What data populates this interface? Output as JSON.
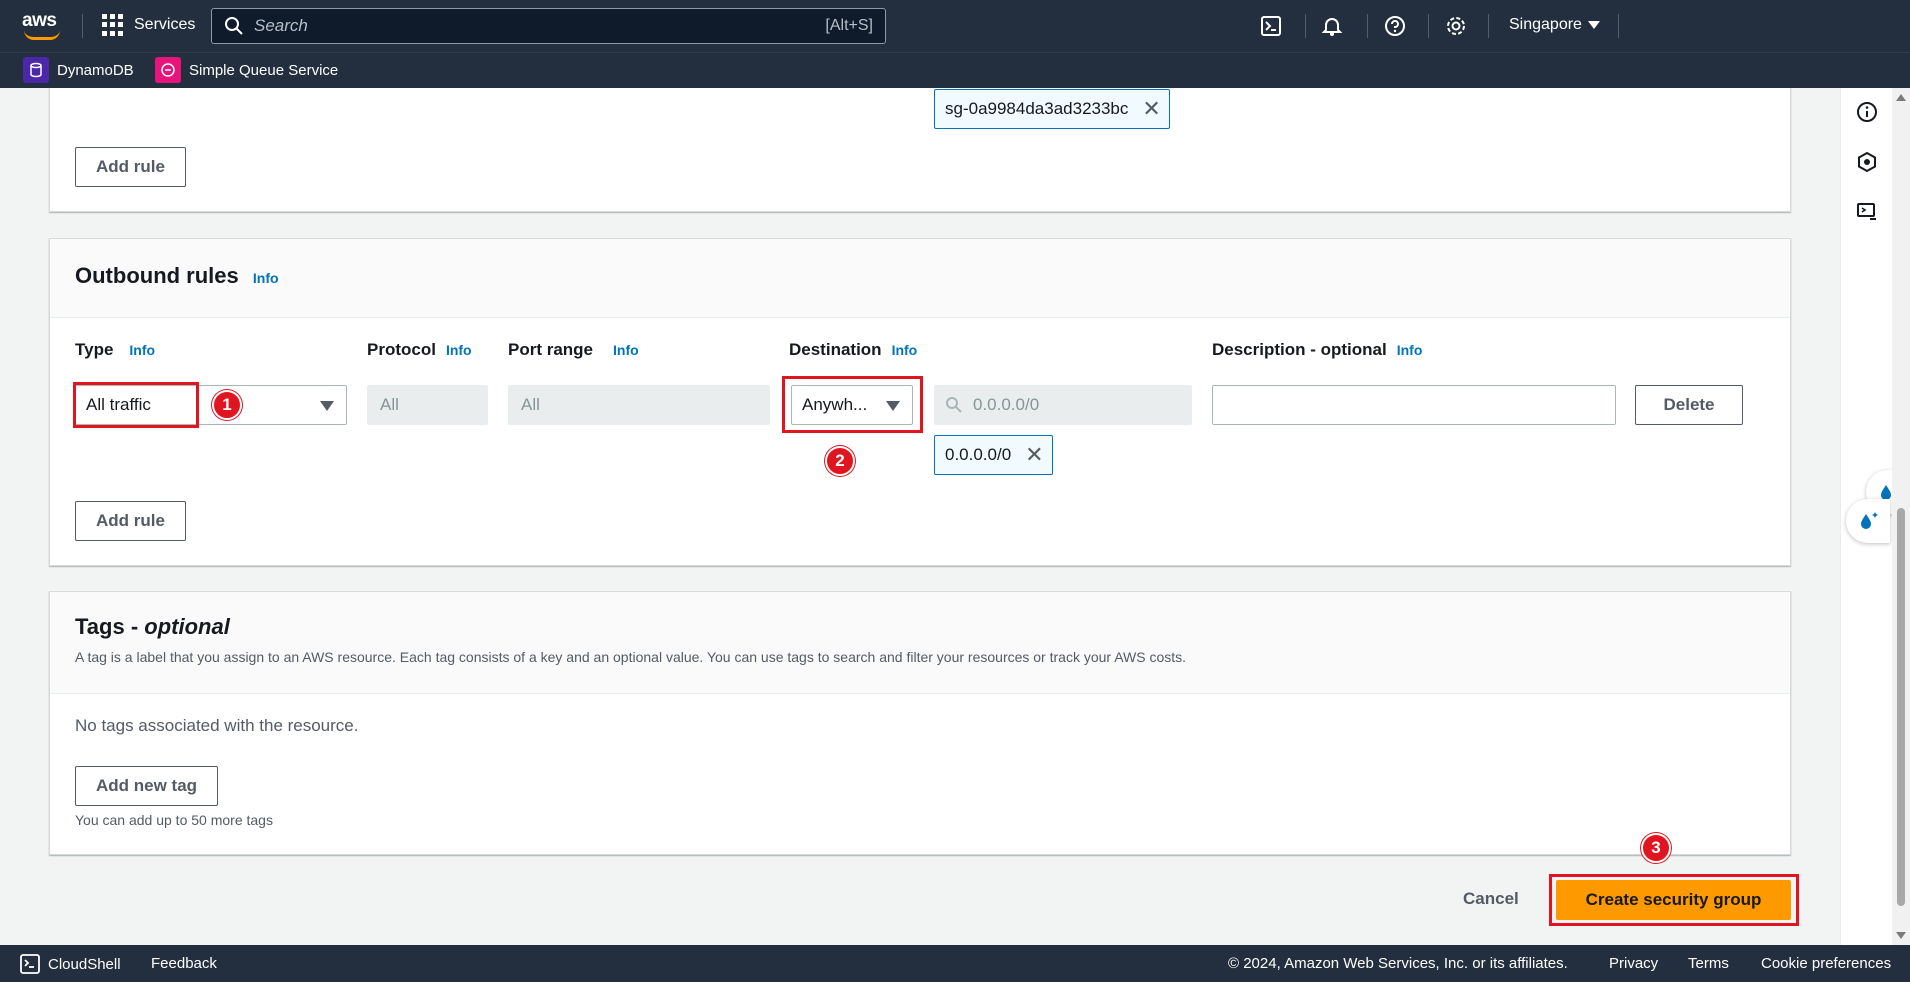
{
  "topnav": {
    "logo_text": "aws",
    "services_label": "Services",
    "search_placeholder": "Search",
    "search_shortcut": "[Alt+S]",
    "region": "Singapore"
  },
  "favorites": [
    {
      "label": "DynamoDB",
      "color": "#4d27aa"
    },
    {
      "label": "Simple Queue Service",
      "color": "#e7157b"
    }
  ],
  "inbound_partial": {
    "source_token": "sg-0a9984da3ad3233bc",
    "add_rule_label": "Add rule"
  },
  "outbound": {
    "title": "Outbound rules",
    "info": "Info",
    "columns": {
      "type": "Type",
      "protocol": "Protocol",
      "port_range": "Port range",
      "destination": "Destination",
      "description": "Description - optional"
    },
    "row": {
      "type_value": "All traffic",
      "protocol_value": "All",
      "port_value": "All",
      "destination_value": "Anywh...",
      "cidr_placeholder": "0.0.0.0/0",
      "cidr_token": "0.0.0.0/0",
      "description_value": "",
      "delete_label": "Delete"
    },
    "add_rule_label": "Add rule"
  },
  "tags": {
    "title_main": "Tags - ",
    "title_optional": "optional",
    "description": "A tag is a label that you assign to an AWS resource. Each tag consists of a key and an optional value. You can use tags to search and filter your resources or track your AWS costs.",
    "empty_text": "No tags associated with the resource.",
    "add_tag_label": "Add new tag",
    "hint": "You can add up to 50 more tags"
  },
  "actions": {
    "cancel_label": "Cancel",
    "create_label": "Create security group"
  },
  "annotations": {
    "badge1": "1",
    "badge2": "2",
    "badge3": "3"
  },
  "footer": {
    "cloudshell": "CloudShell",
    "feedback": "Feedback",
    "copyright": "© 2024, Amazon Web Services, Inc. or its affiliates.",
    "privacy": "Privacy",
    "terms": "Terms",
    "cookie": "Cookie preferences"
  },
  "colors": {
    "nav_bg": "#232f3e",
    "accent": "#ff9900",
    "link": "#0073bb",
    "annotation_red": "#e0151f"
  }
}
